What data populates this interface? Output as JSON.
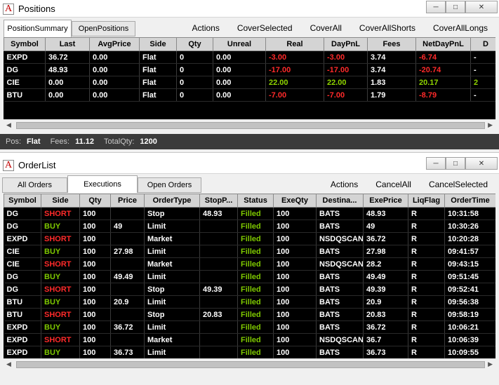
{
  "positions_window": {
    "title": "Positions",
    "tabs": [
      "PositionSummary",
      "OpenPositions"
    ],
    "actions": [
      "Actions",
      "CoverSelected",
      "CoverAll",
      "CoverAllShorts",
      "CoverAllLongs"
    ],
    "columns": [
      "Symbol",
      "Last",
      "AvgPrice",
      "Side",
      "Qty",
      "Unreal",
      "Real",
      "DayPnL",
      "Fees",
      "NetDayPnL",
      "D"
    ],
    "rows": [
      [
        "EXPD",
        "36.72",
        "0.00",
        "Flat",
        "0",
        "0.00",
        "-3.00",
        "-3.00",
        "3.74",
        "-6.74",
        "-"
      ],
      [
        "DG",
        "48.93",
        "0.00",
        "Flat",
        "0",
        "0.00",
        "-17.00",
        "-17.00",
        "3.74",
        "-20.74",
        "-"
      ],
      [
        "CIE",
        "0.00",
        "0.00",
        "Flat",
        "0",
        "0.00",
        "22.00",
        "22.00",
        "1.83",
        "20.17",
        "2"
      ],
      [
        "BTU",
        "0.00",
        "0.00",
        "Flat",
        "0",
        "0.00",
        "-7.00",
        "-7.00",
        "1.79",
        "-8.79",
        "-"
      ]
    ],
    "status": {
      "pos_label": "Pos:",
      "pos_value": "Flat",
      "fees_label": "Fees:",
      "fees_value": "11.12",
      "totalqty_label": "TotalQty:",
      "totalqty_value": "1200"
    }
  },
  "orders_window": {
    "title": "OrderList",
    "tabs": [
      "All Orders",
      "Executions",
      "Open Orders"
    ],
    "actions": [
      "Actions",
      "CancelAll",
      "CancelSelected"
    ],
    "columns": [
      "Symbol",
      "Side",
      "Qty",
      "Price",
      "OrderType",
      "StopP...",
      "Status",
      "ExeQty",
      "Destina...",
      "ExePrice",
      "LiqFlag",
      "OrderTime"
    ],
    "rows": [
      [
        "DG",
        "SHORT",
        "100",
        "",
        "Stop",
        "48.93",
        "Filled",
        "100",
        "BATS",
        "48.93",
        "R",
        "10:31:58"
      ],
      [
        "DG",
        "BUY",
        "100",
        "49",
        "Limit",
        "",
        "Filled",
        "100",
        "BATS",
        "49",
        "R",
        "10:30:26"
      ],
      [
        "EXPD",
        "SHORT",
        "100",
        "",
        "Market",
        "",
        "Filled",
        "100",
        "NSDQSCAN",
        "36.72",
        "R",
        "10:20:28"
      ],
      [
        "CIE",
        "BUY",
        "100",
        "27.98",
        "Limit",
        "",
        "Filled",
        "100",
        "BATS",
        "27.98",
        "R",
        "09:41:57"
      ],
      [
        "CIE",
        "SHORT",
        "100",
        "",
        "Market",
        "",
        "Filled",
        "100",
        "NSDQSCAN",
        "28.2",
        "R",
        "09:43:15"
      ],
      [
        "DG",
        "BUY",
        "100",
        "49.49",
        "Limit",
        "",
        "Filled",
        "100",
        "BATS",
        "49.49",
        "R",
        "09:51:45"
      ],
      [
        "DG",
        "SHORT",
        "100",
        "",
        "Stop",
        "49.39",
        "Filled",
        "100",
        "BATS",
        "49.39",
        "R",
        "09:52:41"
      ],
      [
        "BTU",
        "BUY",
        "100",
        "20.9",
        "Limit",
        "",
        "Filled",
        "100",
        "BATS",
        "20.9",
        "R",
        "09:56:38"
      ],
      [
        "BTU",
        "SHORT",
        "100",
        "",
        "Stop",
        "20.83",
        "Filled",
        "100",
        "BATS",
        "20.83",
        "R",
        "09:58:19"
      ],
      [
        "EXPD",
        "BUY",
        "100",
        "36.72",
        "Limit",
        "",
        "Filled",
        "100",
        "BATS",
        "36.72",
        "R",
        "10:06:21"
      ],
      [
        "EXPD",
        "SHORT",
        "100",
        "",
        "Market",
        "",
        "Filled",
        "100",
        "NSDQSCAN",
        "36.7",
        "R",
        "10:06:39"
      ],
      [
        "EXPD",
        "BUY",
        "100",
        "36.73",
        "Limit",
        "",
        "Filled",
        "100",
        "BATS",
        "36.73",
        "R",
        "10:09:55"
      ]
    ]
  },
  "colors": {
    "negative": "#ff2a2a",
    "positive": "#8fd400",
    "grid_bg": "#000000",
    "status_bg": "#3b3b3b"
  },
  "icons": [
    "app-logo-icon",
    "minimize-icon",
    "maximize-icon",
    "close-icon",
    "scroll-left-icon",
    "scroll-right-icon"
  ]
}
